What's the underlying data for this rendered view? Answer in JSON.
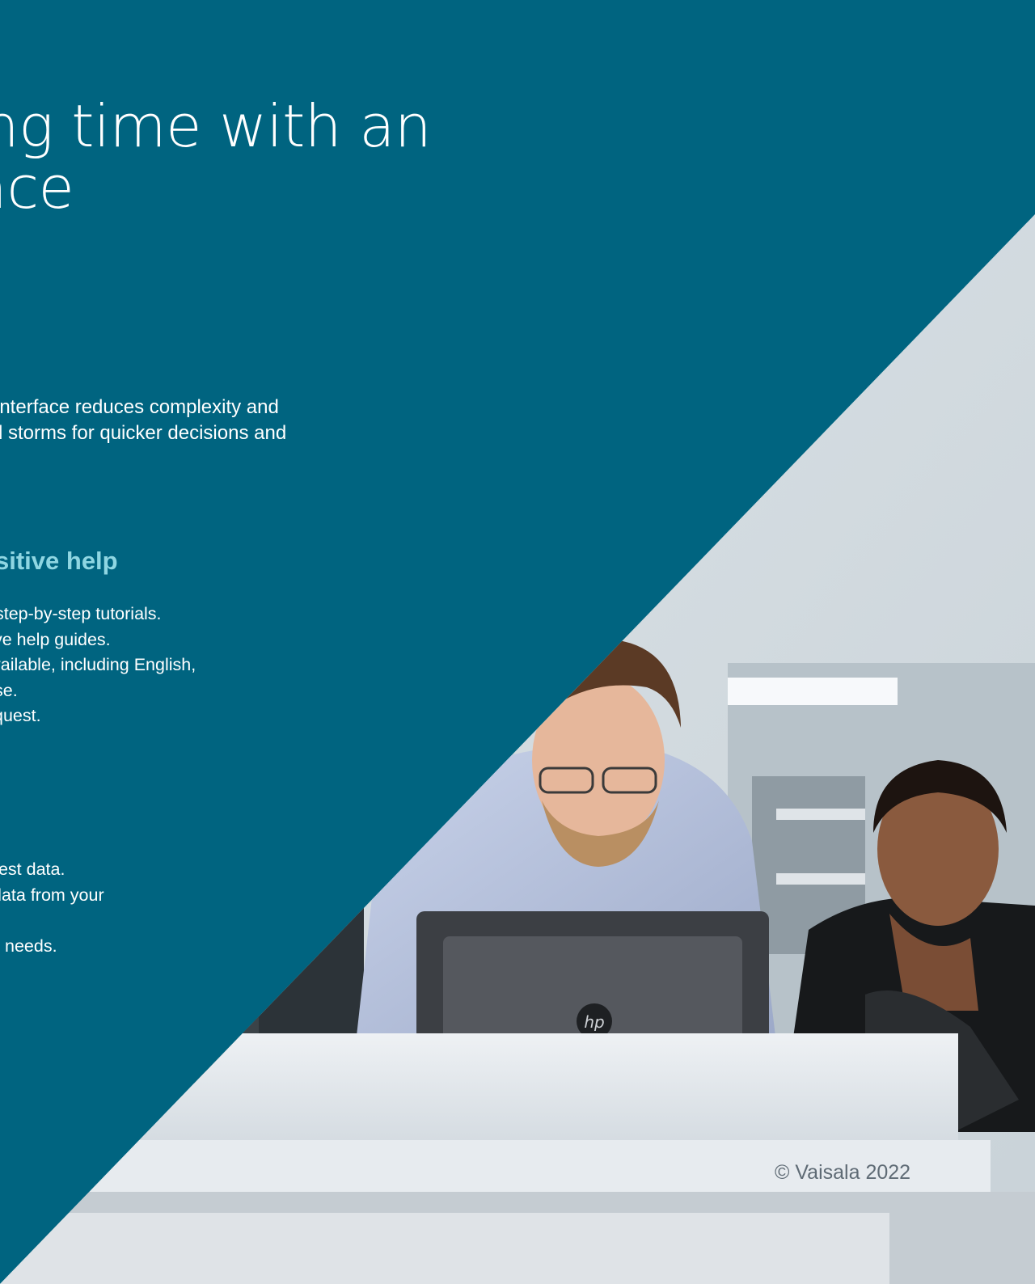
{
  "page": {
    "headline_lines": [
      "ng time with an",
      "face"
    ],
    "intro_lines": [
      "interface reduces complexity and",
      "d storms for quicker decisions and"
    ],
    "section_title": "sitive help",
    "list_one": [
      "step-by-step tutorials.",
      "ve help guides.",
      "vailable, including English,",
      "se.",
      "quest."
    ],
    "list_two": [
      "test data.",
      "data from your",
      "needs."
    ],
    "copyright": "© Vaisala 2022"
  },
  "photo": {
    "subject": "two men looking at a laptop in an office",
    "laptop_logo": "hp"
  },
  "colors": {
    "teal": "#006480",
    "section_title": "#8fd6e2",
    "copyright": "#5f6b75"
  }
}
